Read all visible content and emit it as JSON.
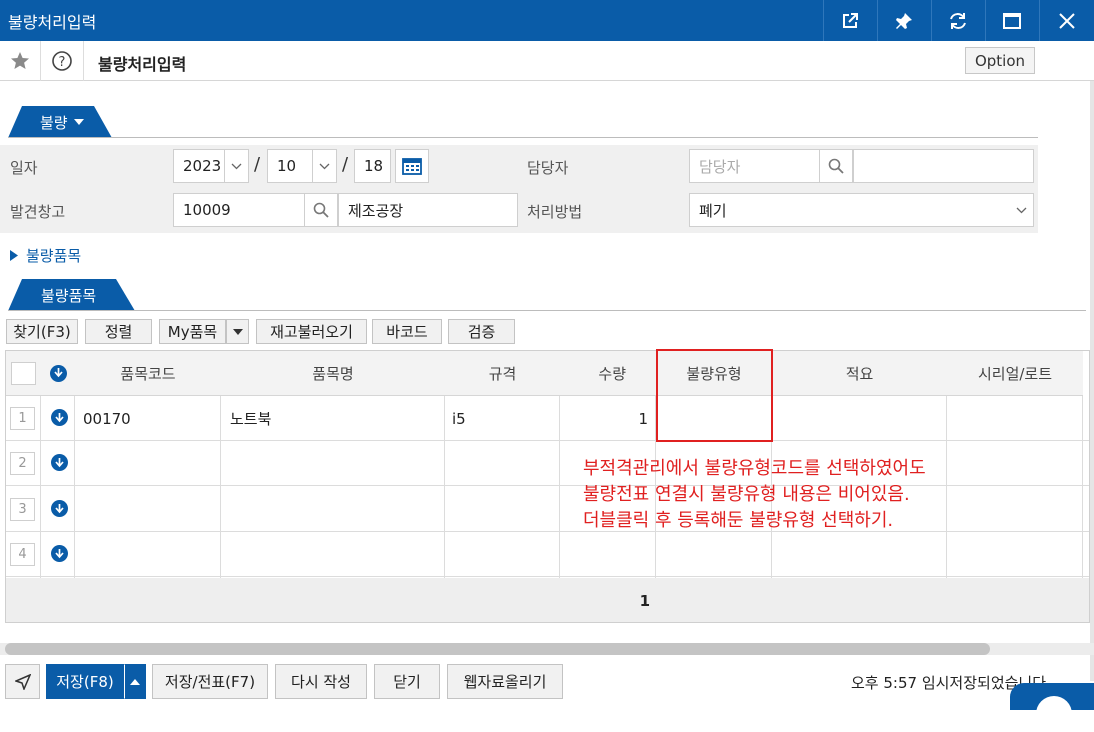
{
  "window": {
    "title": "불량처리입력",
    "buttons": [
      "external-link-icon",
      "pin-icon",
      "refresh-icon",
      "maximize-icon",
      "close-icon"
    ]
  },
  "toolbar": {
    "page_title": "불량처리입력",
    "option_label": "Option"
  },
  "section_main": {
    "tab_label": "불량",
    "fields": {
      "date_label": "일자",
      "date_year": "2023",
      "date_month": "10",
      "date_day": "18",
      "date_sep1": "/",
      "date_sep2": "/",
      "manager_label": "담당자",
      "manager_placeholder": "담당자",
      "warehouse_label": "발견창고",
      "warehouse_code": "10009",
      "warehouse_name": "제조공장",
      "method_label": "처리방법",
      "method_value": "폐기"
    },
    "expander_label": "불량품목"
  },
  "section_items": {
    "tab_label": "불량품목",
    "buttons": {
      "find": "찾기(F3)",
      "sort": "정렬",
      "my_items": "My품목",
      "load_stock": "재고불러오기",
      "barcode": "바코드",
      "verify": "검증"
    },
    "columns": [
      "품목코드",
      "품목명",
      "규격",
      "수량",
      "불량유형",
      "적요",
      "시리얼/로트"
    ],
    "rows": [
      {
        "num": "1",
        "code": "00170",
        "name": "노트북",
        "spec": "i5",
        "qty": "1",
        "defect": "",
        "memo": "",
        "serial": ""
      },
      {
        "num": "2",
        "code": "",
        "name": "",
        "spec": "",
        "qty": "",
        "defect": "",
        "memo": "",
        "serial": ""
      },
      {
        "num": "3",
        "code": "",
        "name": "",
        "spec": "",
        "qty": "",
        "defect": "",
        "memo": "",
        "serial": ""
      },
      {
        "num": "4",
        "code": "",
        "name": "",
        "spec": "",
        "qty": "",
        "defect": "",
        "memo": "",
        "serial": ""
      }
    ],
    "total_qty": "1"
  },
  "annotation": {
    "line1": "부적격관리에서 불량유형코드를 선택하였어도",
    "line2": "불량전표 연결시 불량유형 내용은 비어있음.",
    "line3": "더블클릭 후 등록해둔 불량유형 선택하기.",
    "color": "#e02020"
  },
  "bottom": {
    "save": "저장(F8)",
    "save_slip": "저장/전표(F7)",
    "rewrite": "다시 작성",
    "close": "닫기",
    "upload": "웹자료올리기",
    "status": "오후 5:57 임시저장되었습니다"
  },
  "colors": {
    "brand": "#0a5ca8"
  }
}
